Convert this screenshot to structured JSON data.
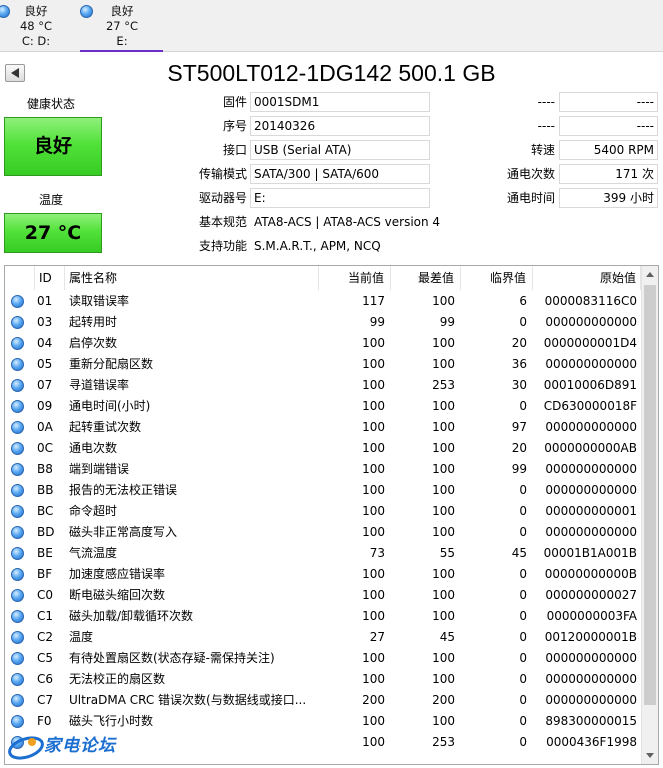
{
  "drives": [
    {
      "status": "良好",
      "temperature": "48 °C",
      "letters": "C: D:",
      "active": false
    },
    {
      "status": "良好",
      "temperature": "27 °C",
      "letters": "E:",
      "active": true
    }
  ],
  "title": "ST500LT012-1DG142 500.1 GB",
  "health": {
    "label": "健康状态",
    "value": "良好"
  },
  "temperature": {
    "label": "温度",
    "value": "27 °C"
  },
  "info": {
    "firmware": {
      "label": "固件",
      "value": "0001SDM1"
    },
    "serial": {
      "label": "序号",
      "value": "20140326"
    },
    "interface": {
      "label": "接口",
      "value": "USB (Serial ATA)"
    },
    "transfer_mode": {
      "label": "传输模式",
      "value": "SATA/300 | SATA/600"
    },
    "drive_letter": {
      "label": "驱动器号",
      "value": "E:"
    },
    "standard": {
      "label": "基本规范",
      "value": "ATA8-ACS | ATA8-ACS version 4"
    },
    "features": {
      "label": "支持功能",
      "value": "S.M.A.R.T., APM, NCQ"
    },
    "dash1": {
      "label": "----",
      "value": "----"
    },
    "dash2": {
      "label": "----",
      "value": "----"
    },
    "rotation": {
      "label": "转速",
      "value": "5400 RPM"
    },
    "power_on_count": {
      "label": "通电次数",
      "value": "171 次"
    },
    "power_on_hours": {
      "label": "通电时间",
      "value": "399 小时"
    }
  },
  "table": {
    "headers": {
      "id": "ID",
      "name": "属性名称",
      "current": "当前值",
      "worst": "最差值",
      "threshold": "临界值",
      "raw": "原始值"
    },
    "rows": [
      {
        "id": "01",
        "name": "读取错误率",
        "current": "117",
        "worst": "100",
        "threshold": "6",
        "raw": "0000083116C0"
      },
      {
        "id": "03",
        "name": "起转用时",
        "current": "99",
        "worst": "99",
        "threshold": "0",
        "raw": "000000000000"
      },
      {
        "id": "04",
        "name": "启停次数",
        "current": "100",
        "worst": "100",
        "threshold": "20",
        "raw": "0000000001D4"
      },
      {
        "id": "05",
        "name": "重新分配扇区数",
        "current": "100",
        "worst": "100",
        "threshold": "36",
        "raw": "000000000000"
      },
      {
        "id": "07",
        "name": "寻道错误率",
        "current": "100",
        "worst": "253",
        "threshold": "30",
        "raw": "00010006D891"
      },
      {
        "id": "09",
        "name": "通电时间(小时)",
        "current": "100",
        "worst": "100",
        "threshold": "0",
        "raw": "CD630000018F"
      },
      {
        "id": "0A",
        "name": "起转重试次数",
        "current": "100",
        "worst": "100",
        "threshold": "97",
        "raw": "000000000000"
      },
      {
        "id": "0C",
        "name": "通电次数",
        "current": "100",
        "worst": "100",
        "threshold": "20",
        "raw": "0000000000AB"
      },
      {
        "id": "B8",
        "name": "端到端错误",
        "current": "100",
        "worst": "100",
        "threshold": "99",
        "raw": "000000000000"
      },
      {
        "id": "BB",
        "name": "报告的无法校正错误",
        "current": "100",
        "worst": "100",
        "threshold": "0",
        "raw": "000000000000"
      },
      {
        "id": "BC",
        "name": "命令超时",
        "current": "100",
        "worst": "100",
        "threshold": "0",
        "raw": "000000000001"
      },
      {
        "id": "BD",
        "name": "磁头非正常高度写入",
        "current": "100",
        "worst": "100",
        "threshold": "0",
        "raw": "000000000000"
      },
      {
        "id": "BE",
        "name": "气流温度",
        "current": "73",
        "worst": "55",
        "threshold": "45",
        "raw": "00001B1A001B"
      },
      {
        "id": "BF",
        "name": "加速度感应错误率",
        "current": "100",
        "worst": "100",
        "threshold": "0",
        "raw": "00000000000B"
      },
      {
        "id": "C0",
        "name": "断电磁头缩回次数",
        "current": "100",
        "worst": "100",
        "threshold": "0",
        "raw": "000000000027"
      },
      {
        "id": "C1",
        "name": "磁头加载/卸载循环次数",
        "current": "100",
        "worst": "100",
        "threshold": "0",
        "raw": "0000000003FA"
      },
      {
        "id": "C2",
        "name": "温度",
        "current": "27",
        "worst": "45",
        "threshold": "0",
        "raw": "00120000001B"
      },
      {
        "id": "C5",
        "name": "有待处置扇区数(状态存疑-需保持关注)",
        "current": "100",
        "worst": "100",
        "threshold": "0",
        "raw": "000000000000"
      },
      {
        "id": "C6",
        "name": "无法校正的扇区数",
        "current": "100",
        "worst": "100",
        "threshold": "0",
        "raw": "000000000000"
      },
      {
        "id": "C7",
        "name": "UltraDMA CRC 错误次数(与数据线或接口...",
        "current": "200",
        "worst": "200",
        "threshold": "0",
        "raw": "000000000000"
      },
      {
        "id": "F0",
        "name": "磁头飞行小时数",
        "current": "100",
        "worst": "100",
        "threshold": "0",
        "raw": "898300000015"
      },
      {
        "id": "",
        "name": "入",
        "current": "100",
        "worst": "253",
        "threshold": "0",
        "raw": "0000436F1998"
      }
    ]
  },
  "watermark": {
    "text": "家电论坛"
  }
}
